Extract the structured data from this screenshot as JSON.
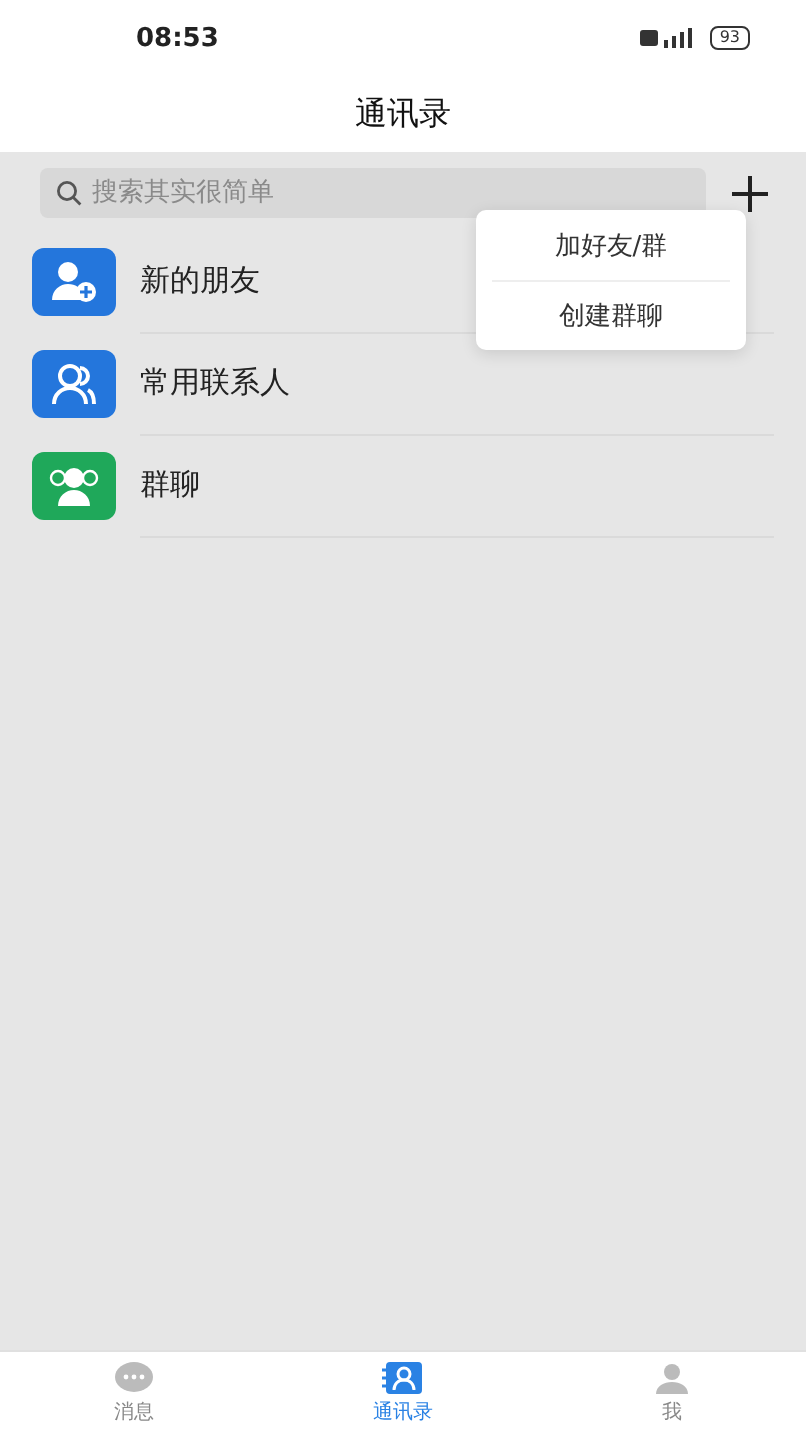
{
  "status_bar": {
    "time": "08:53",
    "battery": "93"
  },
  "header": {
    "title": "通讯录"
  },
  "search": {
    "placeholder": "搜索其实很简单"
  },
  "contacts": [
    {
      "label": "新的朋友",
      "kind": "new-friend"
    },
    {
      "label": "常用联系人",
      "kind": "frequent"
    },
    {
      "label": "群聊",
      "kind": "group"
    }
  ],
  "popup_menu": {
    "items": [
      "加好友/群",
      "创建群聊"
    ]
  },
  "tabs": [
    {
      "label": "消息",
      "kind": "chat",
      "selected": false
    },
    {
      "label": "通讯录",
      "kind": "contacts",
      "selected": true
    },
    {
      "label": "我",
      "kind": "me",
      "selected": false
    }
  ]
}
